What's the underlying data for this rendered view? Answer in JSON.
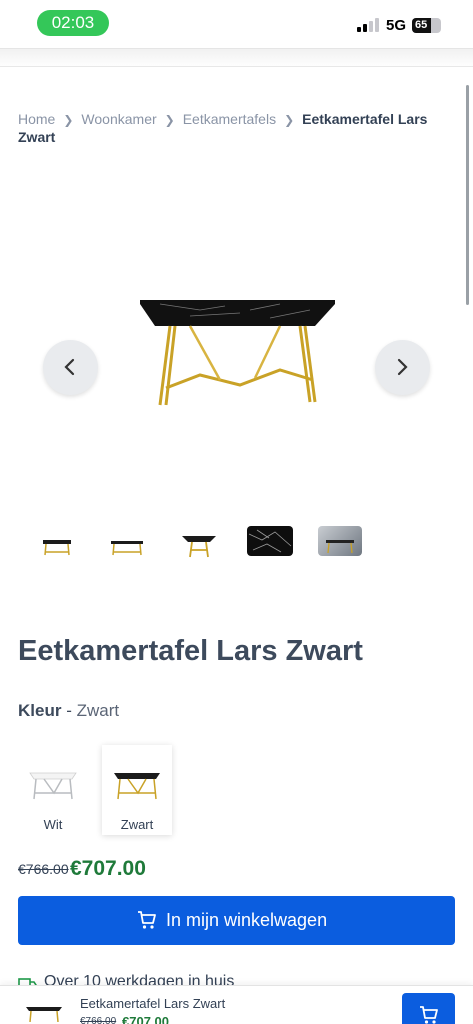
{
  "status_bar": {
    "time": "02:03",
    "network": "5G",
    "battery": "65",
    "battery_level": 0.65
  },
  "breadcrumb": {
    "items": [
      "Home",
      "Woonkamer",
      "Eetkamertafels"
    ],
    "current": "Eetkamertafel Lars Zwart"
  },
  "gallery": {
    "thumbnail_count": 5,
    "prev_icon": "chevron-left-icon",
    "next_icon": "chevron-right-icon"
  },
  "product": {
    "title": "Eetkamertafel Lars Zwart",
    "color_label": "Kleur",
    "color_sep": "-",
    "color_value": "Zwart",
    "swatches": [
      {
        "label": "Wit",
        "selected": false
      },
      {
        "label": "Zwart",
        "selected": true
      }
    ],
    "old_price": "€766.00",
    "new_price": "€707.00",
    "cart_button": "In mijn winkelwagen",
    "delivery_text": "Over 10 werkdagen in huis"
  },
  "sticky_bar": {
    "title": "Eetkamertafel Lars Zwart",
    "old_price": "€766.00",
    "new_price": "€707.00"
  },
  "colors": {
    "primary": "#0b5ddf",
    "price_green": "#1f7a3a",
    "text": "#334155",
    "time_pill": "#34c759"
  }
}
